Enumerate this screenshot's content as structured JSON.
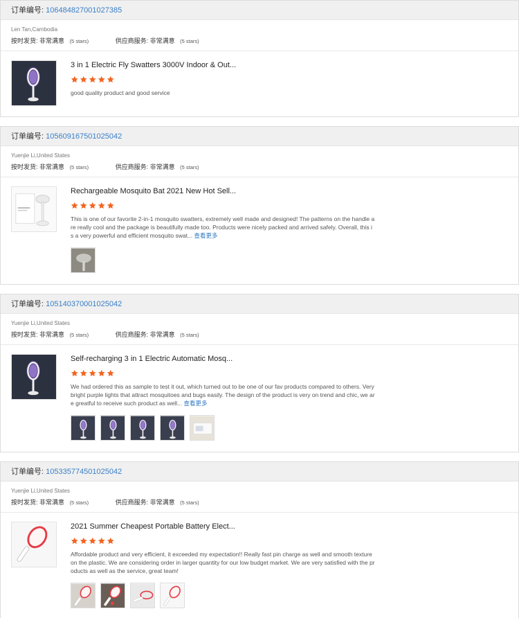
{
  "order_label": "订单编号:",
  "on_time_label": "按时发货:",
  "supplier_label": "供应商服务:",
  "colors": {
    "accent_link": "#3a7fc8",
    "star": "#f26522",
    "header_bg": "#f0f0f0"
  },
  "cards": [
    {
      "order_number": "106484827001027385",
      "buyer": "Len Tan,Cambodia",
      "on_time_value": "非常满意",
      "on_time_stars": "(5 stars)",
      "supplier_value": "非常满意",
      "supplier_stars": "(5 stars)",
      "product_title": "3 in 1 Electric Fly Swatters 3000V Indoor & Out...",
      "rating": 5,
      "review": "good quality product and good service",
      "more": "",
      "thumb": "purple-swatter-dark",
      "photos": []
    },
    {
      "order_number": "105609167501025042",
      "buyer": "Yuenjie Li,United States",
      "on_time_value": "非常满意",
      "on_time_stars": "(5 stars)",
      "supplier_value": "非常满意",
      "supplier_stars": "(5 stars)",
      "product_title": "Rechargeable Mosquito Bat 2021 New Hot Sell...",
      "rating": 5,
      "review": "This is one of our favorite 2-in-1 mosquito swatters, extremely well made and designed! The patterns on the handle are really cool and the package is beautifully made too. Products were nicely packed and arrived safely. Overall, this is a very powerful and efficient mosquito swat...",
      "more": "查看更多",
      "thumb": "white-swatter-box",
      "photos": [
        "gray-swatter"
      ]
    },
    {
      "order_number": "105140370001025042",
      "buyer": "Yuenjie Li,United States",
      "on_time_value": "非常满意",
      "on_time_stars": "(5 stars)",
      "supplier_value": "非常满意",
      "supplier_stars": "(5 stars)",
      "product_title": "Self-recharging 3 in 1 Electric Automatic Mosq...",
      "rating": 5,
      "review": "We had ordered this as sample to test it out, which turned out to be one of our fav products compared to others. Very bright purple lights that attract mosquitoes and bugs easily. The design of the product is very on trend and chic, we are greatful to receive such product as well...",
      "more": "查看更多",
      "thumb": "purple-swatter-dark",
      "photos": [
        "purple-swatter",
        "purple-swatter-angled",
        "purple-swatter-base",
        "purple-swatter-glow",
        "boxed-swatter"
      ]
    },
    {
      "order_number": "105335774501025042",
      "buyer": "Yuenjie Li,United States",
      "on_time_value": "非常满意",
      "on_time_stars": "(5 stars)",
      "supplier_value": "非常满意",
      "supplier_stars": "(5 stars)",
      "product_title": "2021 Summer Cheapest Portable Battery Elect...",
      "rating": 5,
      "review": "Affordable product and very efficient, it exceeded my expectation!! Really fast pin charge as well and smooth texture on the plastic. We are considering order in larger quantity for our low budget market. We are very satisfied with the products as well as the service, great team!",
      "more": "",
      "thumb": "red-swatter",
      "photos": [
        "red-swatter-hand",
        "red-swatter-light",
        "red-swatter-flat",
        "red-swatter-white"
      ]
    }
  ]
}
